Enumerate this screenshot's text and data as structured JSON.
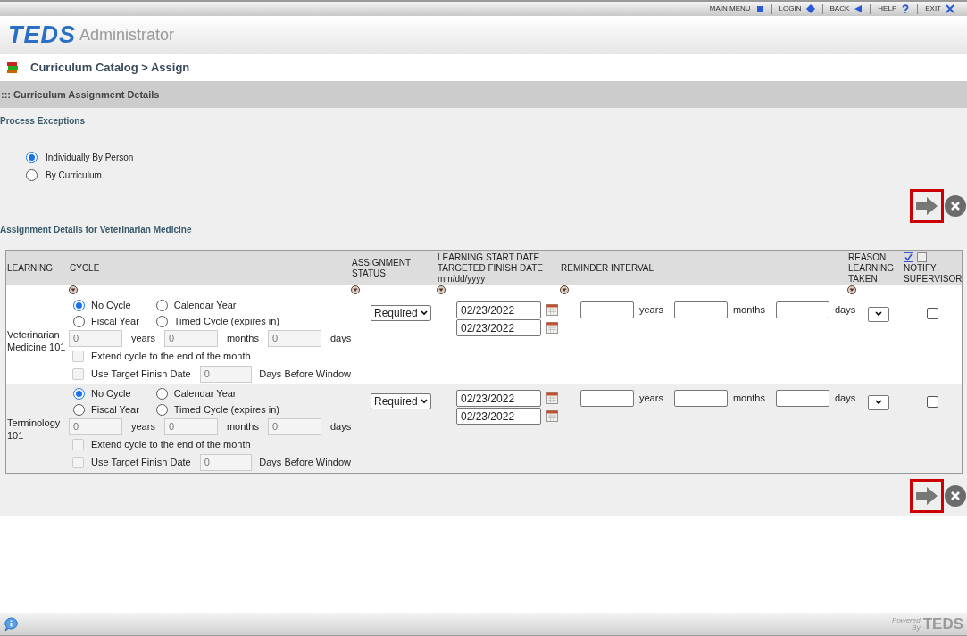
{
  "top_menu": [
    {
      "label": "MAIN MENU"
    },
    {
      "label": "LOGIN"
    },
    {
      "label": "BACK"
    },
    {
      "label": "HELP"
    },
    {
      "label": "EXIT"
    }
  ],
  "logo": {
    "mark": "TEDS",
    "product": "Administrator"
  },
  "breadcrumb": "Curriculum Catalog > Assign",
  "section_title": "::: Curriculum Assignment Details",
  "process_exceptions": {
    "title": "Process Exceptions",
    "options": [
      {
        "label": "Individually By Person",
        "selected": true
      },
      {
        "label": "By Curriculum",
        "selected": false
      }
    ]
  },
  "details_title": "Assignment Details for Veterinarian Medicine",
  "columns": [
    {
      "lines": [
        "LEARNING"
      ],
      "sort": false
    },
    {
      "lines": [
        "CYCLE"
      ],
      "sort": true
    },
    {
      "lines": [
        "ASSIGNMENT",
        "STATUS"
      ],
      "sort": true
    },
    {
      "lines": [
        "LEARNING START DATE",
        "TARGETED FINISH DATE",
        "mm/dd/yyyy"
      ],
      "sort": true
    },
    {
      "lines": [
        "REMINDER INTERVAL"
      ],
      "sort": true
    },
    {
      "lines": [
        "REASON",
        "LEARNING",
        "TAKEN"
      ],
      "sort": true
    },
    {
      "lines": [
        "NOTIFY",
        "SUPERVISOR"
      ],
      "sort": false,
      "kind": "notify"
    }
  ],
  "notify_header_toggles": [
    {
      "checked": true
    },
    {
      "checked": false
    }
  ],
  "rows": [
    {
      "learning": "Veterinarian Medicine 101",
      "cycle_options": [
        {
          "label": "No Cycle",
          "selected": true
        },
        {
          "label": "Calendar Year",
          "selected": false
        },
        {
          "label": "Fiscal Year",
          "selected": false
        },
        {
          "label": "Timed Cycle (expires in)",
          "selected": false
        }
      ],
      "cycle_fields": [
        {
          "value": "0",
          "unit": "years"
        },
        {
          "value": "0",
          "unit": "months"
        },
        {
          "value": "0",
          "unit": "days"
        }
      ],
      "extend": {
        "label": "Extend cycle to the end of the month",
        "checked": false,
        "disabled": true
      },
      "use_target": {
        "label": "Use Target Finish Date",
        "checked": false,
        "disabled": true,
        "value": "0",
        "suffix": "Days Before Window"
      },
      "status": "Required",
      "start_date": "02/23/2022",
      "finish_date": "02/23/2022",
      "reminder_units": [
        "years",
        "months",
        "days"
      ],
      "notify": false
    },
    {
      "learning": "Terminology 101",
      "cycle_options": [
        {
          "label": "No Cycle",
          "selected": true
        },
        {
          "label": "Calendar Year",
          "selected": false
        },
        {
          "label": "Fiscal Year",
          "selected": false
        },
        {
          "label": "Timed Cycle (expires in)",
          "selected": false
        }
      ],
      "cycle_fields": [
        {
          "value": "0",
          "unit": "years"
        },
        {
          "value": "0",
          "unit": "months"
        },
        {
          "value": "0",
          "unit": "days"
        }
      ],
      "extend": {
        "label": "Extend cycle to the end of the month",
        "checked": false,
        "disabled": true
      },
      "use_target": {
        "label": "Use Target Finish Date",
        "checked": false,
        "disabled": true,
        "value": "0",
        "suffix": "Days Before Window"
      },
      "status": "Required",
      "start_date": "02/23/2022",
      "finish_date": "02/23/2022",
      "reminder_units": [
        "years",
        "months",
        "days"
      ],
      "notify": false
    }
  ],
  "footer": {
    "powered": "Powered",
    "by": "By",
    "mark": "TEDS"
  }
}
